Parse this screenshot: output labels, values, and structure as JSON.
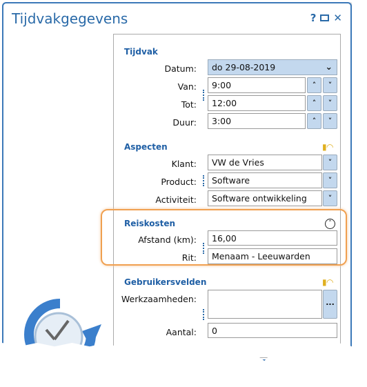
{
  "window": {
    "title": "Tijdvakgegevens",
    "help": "?"
  },
  "tijdvak": {
    "header": "Tijdvak",
    "datum_label": "Datum:",
    "datum_value": "do 29-08-2019",
    "van_label": "Van:",
    "van_value": "9:00",
    "tot_label": "Tot:",
    "tot_value": "12:00",
    "duur_label": "Duur:",
    "duur_value": "3:00"
  },
  "aspecten": {
    "header": "Aspecten",
    "klant_label": "Klant:",
    "klant_value": "VW de Vries",
    "product_label": "Product:",
    "product_value": "Software",
    "activiteit_label": "Activiteit:",
    "activiteit_value": "Software ontwikkeling"
  },
  "reiskosten": {
    "header": "Reiskosten",
    "afstand_label": "Afstand (km):",
    "afstand_value": "16,00",
    "rit_label": "Rit:",
    "rit_value": "Menaam - Leeuwarden"
  },
  "gebruikersvelden": {
    "header": "Gebruikersvelden",
    "werk_label": "Werkzaamheden:",
    "werk_value": "",
    "werk_button": "...",
    "aantal_label": "Aantal:",
    "aantal_value": "0"
  },
  "colors": {
    "accent": "#2a6aa8",
    "highlight": "#f0a050",
    "button": "#c3d8ee"
  }
}
